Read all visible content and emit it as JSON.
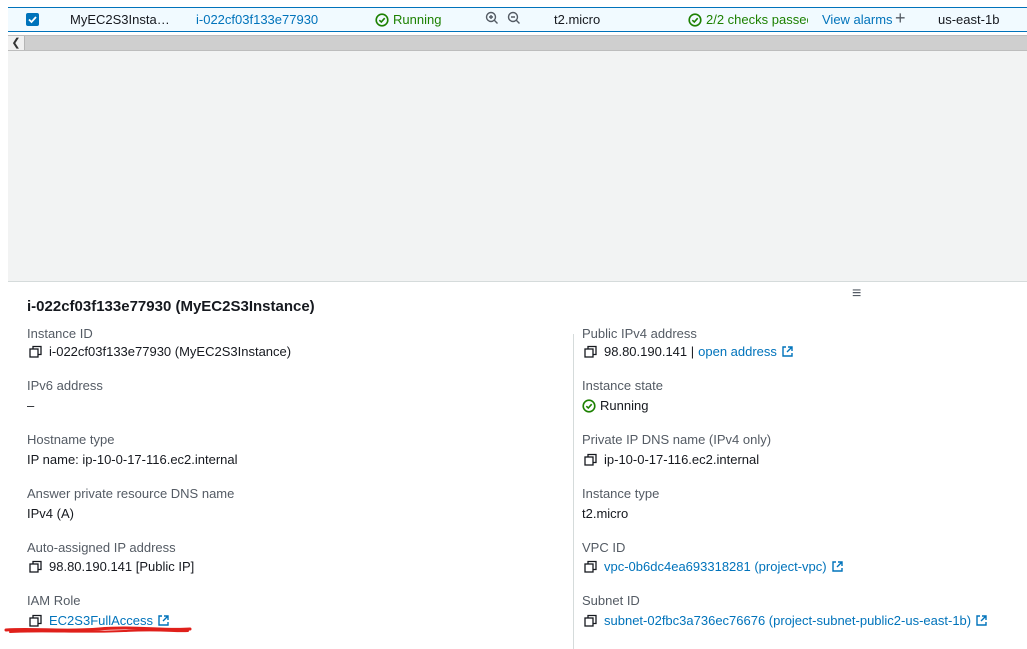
{
  "table": {
    "row": {
      "checked": true,
      "name": "MyEC2S3Insta…",
      "instance_id": "i-022cf03f133e77930",
      "state": "Running",
      "type": "t2.micro",
      "status_check": "2/2 checks passec",
      "alarms_link": "View alarms",
      "az": "us-east-1b"
    }
  },
  "details": {
    "title": "i-022cf03f133e77930 (MyEC2S3Instance)",
    "left": [
      {
        "label": "Instance ID",
        "value": "i-022cf03f133e77930 (MyEC2S3Instance)"
      },
      {
        "label": "IPv6 address",
        "value": "–"
      },
      {
        "label": "Hostname type",
        "value": "IP name: ip-10-0-17-116.ec2.internal"
      },
      {
        "label": "Answer private resource DNS name",
        "value": "IPv4 (A)"
      },
      {
        "label": "Auto-assigned IP address",
        "value": "98.80.190.141 [Public IP]"
      },
      {
        "label": "IAM Role",
        "value": "EC2S3FullAccess"
      }
    ],
    "right": [
      {
        "label": "Public IPv4 address",
        "value": "98.80.190.141 |",
        "link": "open address"
      },
      {
        "label": "Instance state",
        "value": "Running"
      },
      {
        "label": "Private IP DNS name (IPv4 only)",
        "value": "ip-10-0-17-116.ec2.internal"
      },
      {
        "label": "Instance type",
        "value": "t2.micro"
      },
      {
        "label": "VPC ID",
        "value": "vpc-0b6dc4ea693318281 (project-vpc)"
      },
      {
        "label": "Subnet ID",
        "value": "subnet-02fbc3a736ec76676 (project-subnet-public2-us-east-1b)"
      }
    ]
  },
  "colors": {
    "link": "#0073bb",
    "success": "#1d8102",
    "selected_row": "#f1faff"
  }
}
